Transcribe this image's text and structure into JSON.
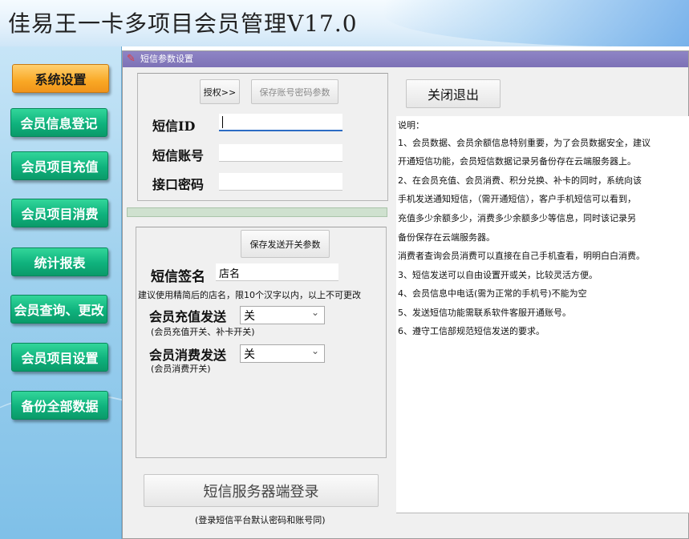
{
  "app": {
    "title": "佳易王一卡多项目会员管理V17.0"
  },
  "sidebar": {
    "items": [
      {
        "label": "系统设置"
      },
      {
        "label": "会员信息登记"
      },
      {
        "label": "会员项目充值"
      },
      {
        "label": "会员项目消费"
      },
      {
        "label": "统计报表"
      },
      {
        "label": "会员查询、更改"
      },
      {
        "label": "会员项目设置"
      },
      {
        "label": "备份全部数据"
      }
    ]
  },
  "window": {
    "title": "短信参数设置"
  },
  "account": {
    "authorize_label": "授权>>",
    "save_label": "保存账号密码参数",
    "sms_id_label": "短信ID",
    "sms_id_value": "",
    "sms_account_label": "短信账号",
    "sms_account_value": "",
    "api_password_label": "接口密码",
    "api_password_value": ""
  },
  "send": {
    "save_switch_label": "保存发送开关参数",
    "signature_label": "短信签名",
    "signature_value": "店名",
    "signature_hint": "建议使用精简后的店名，限10个汉字以内，以上不可更改",
    "recharge_label": "会员充值发送",
    "recharge_value": "关",
    "recharge_hint": "(会员充值开关、补卡开关)",
    "consume_label": "会员消费发送",
    "consume_value": "关",
    "consume_hint": "(会员消费开关)"
  },
  "login": {
    "button_label": "短信服务器端登录",
    "hint": "(登录短信平台默认密码和账号同)"
  },
  "close_label": "关闭退出",
  "notes": {
    "lines": [
      "说明：",
      "1、会员数据、会员余额信息特别重要，为了会员数据安全，建议",
      "开通短信功能，会员短信数据记录另备份存在云端服务器上。",
      "2、在会员充值、会员消费、积分兑换、补卡的同时，系统向该",
      "手机发送通知短信，（需开通短信），客户手机短信可以看到，",
      "充值多少余额多少，消费多少余额多少等信息，同时该记录另",
      "备份保存在云端服务器。",
      "消费者查询会员消费可以直接在自己手机查看，明明白白消费。",
      "3、短信发送可以自由设置开或关，比较灵活方便。",
      "4、会员信息中电话(需为正常的手机号)不能为空",
      "5、发送短信功能需联系软件客服开通账号。",
      "6、遵守工信部规范短信发送的要求。"
    ]
  }
}
